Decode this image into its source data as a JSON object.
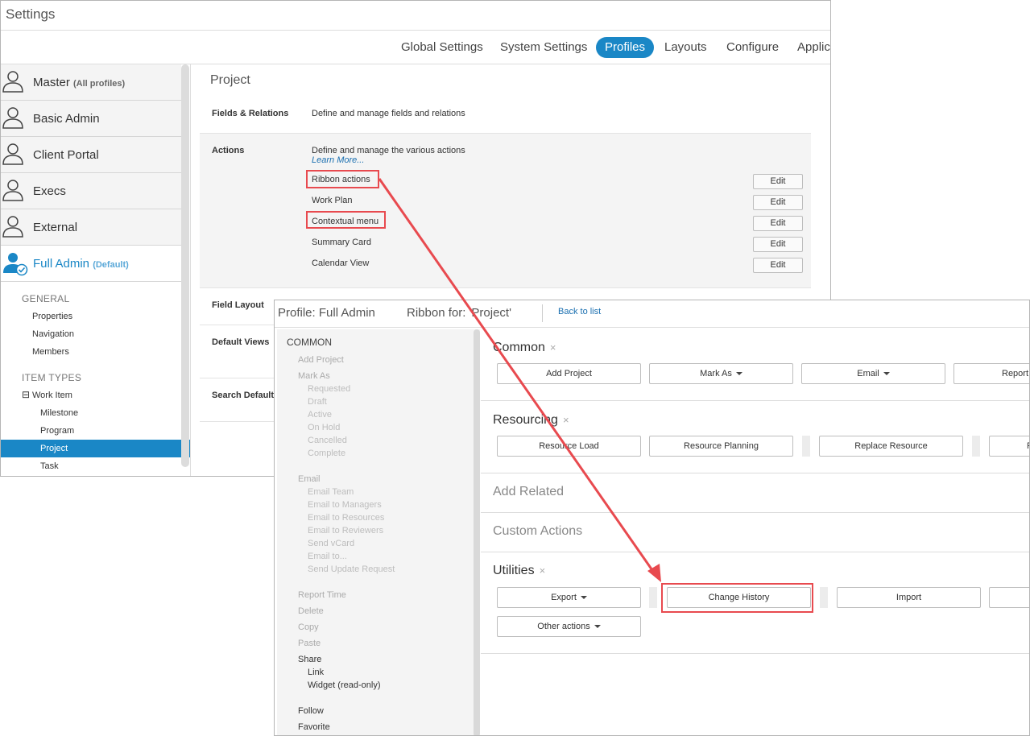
{
  "settings_window": {
    "title": "Settings",
    "tabs": [
      {
        "label": "Global Settings",
        "active": false
      },
      {
        "label": "System Settings",
        "active": false
      },
      {
        "label": "Profiles",
        "active": true
      },
      {
        "label": "Layouts",
        "active": false
      },
      {
        "label": "Configure",
        "active": false
      },
      {
        "label": "Applica",
        "active": false
      }
    ],
    "profiles": [
      {
        "label": "Master",
        "sub": "(All profiles)"
      },
      {
        "label": "Basic Admin",
        "sub": ""
      },
      {
        "label": "Client Portal",
        "sub": ""
      },
      {
        "label": "Execs",
        "sub": ""
      },
      {
        "label": "External",
        "sub": ""
      },
      {
        "label": "Full Admin",
        "sub": "(Default)"
      }
    ],
    "general_heading": "GENERAL",
    "general_items": [
      "Properties",
      "Navigation",
      "Members"
    ],
    "item_types_heading": "ITEM TYPES",
    "tree_toggle": "⊟",
    "work_item": "Work Item",
    "work_item_children": [
      "Milestone",
      "Program",
      "Project",
      "Task"
    ],
    "selected_item": "Project",
    "main_title": "Project",
    "fields_label": "Fields & Relations",
    "fields_desc": "Define and manage fields and relations",
    "actions_label": "Actions",
    "actions_desc": "Define and manage the various actions",
    "learn_more": "Learn More...",
    "action_items": [
      "Ribbon actions",
      "Work Plan",
      "Contextual menu",
      "Summary Card",
      "Calendar View"
    ],
    "edit_label": "Edit",
    "field_layout_label": "Field Layout",
    "default_views_label": "Default Views",
    "search_default_label": "Search Default"
  },
  "ribbon_window": {
    "profile_title": "Profile: Full Admin",
    "ribbon_title": "Ribbon for: 'Project'",
    "back_link": "Back to list",
    "left_panel": {
      "common": "COMMON",
      "add_project": "Add Project",
      "mark_as": "Mark As",
      "mark_as_items": [
        "Requested",
        "Draft",
        "Active",
        "On Hold",
        "Cancelled",
        "Complete"
      ],
      "email": "Email",
      "email_items": [
        "Email Team",
        "Email to Managers",
        "Email to Resources",
        "Email to Reviewers",
        "Send vCard",
        "Email to...",
        "Send Update Request"
      ],
      "report_time": "Report Time",
      "delete": "Delete",
      "copy": "Copy",
      "paste": "Paste",
      "share": "Share",
      "share_items": [
        "Link",
        "Widget (read-only)"
      ],
      "follow": "Follow",
      "favorite": "Favorite"
    },
    "remove_glyph": "×",
    "sections": {
      "common": {
        "title": "Common",
        "buttons": [
          "Add Project",
          "Mark As",
          "Email",
          "Report"
        ]
      },
      "resourcing": {
        "title": "Resourcing",
        "buttons": [
          "Resource Load",
          "Resource Planning",
          "Replace Resource",
          "R"
        ]
      },
      "add_related": {
        "title": "Add Related"
      },
      "custom_actions": {
        "title": "Custom Actions"
      },
      "utilities": {
        "title": "Utilities",
        "buttons": [
          "Export",
          "Change History",
          "Import",
          ""
        ],
        "other": "Other actions"
      }
    }
  },
  "colors": {
    "accent": "#1a87c6",
    "highlight_red": "#e84a4f"
  },
  "icons": [
    "user-icon",
    "user-check-icon",
    "caret-down-icon",
    "close-icon",
    "arrow-annotation"
  ]
}
